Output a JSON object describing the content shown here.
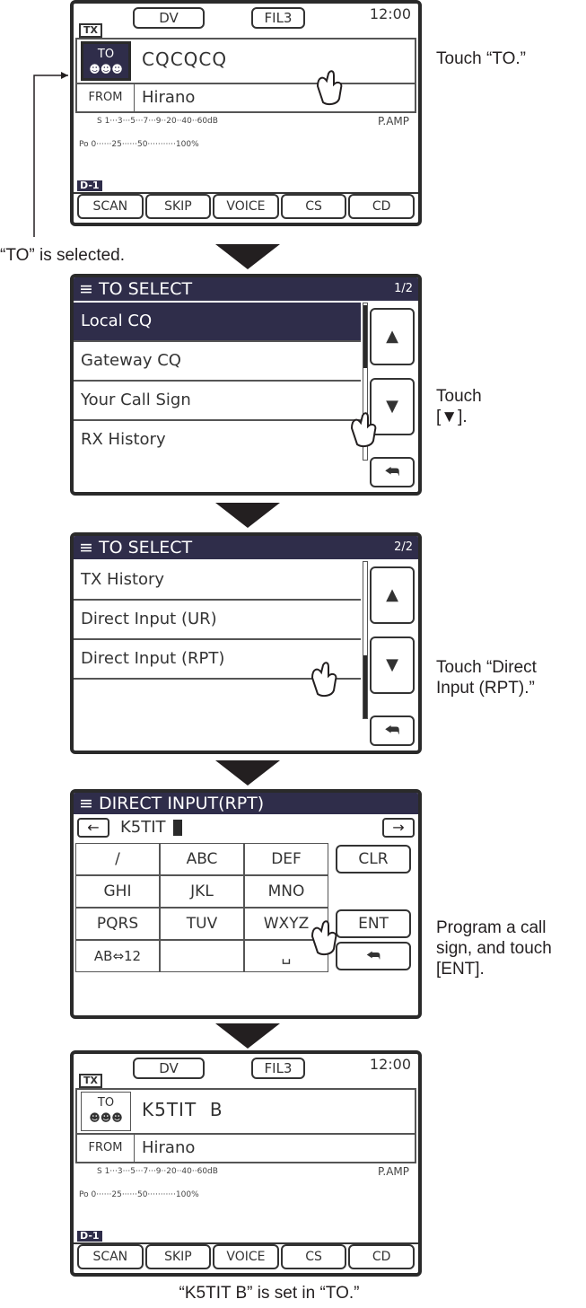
{
  "screen1": {
    "mode": "DV",
    "fil": "FIL3",
    "time": "12:00",
    "tx": "TX",
    "to_label": "TO",
    "to_value": "CQCQCQ",
    "from_label": "FROM",
    "from_value": "Hirano",
    "s_meter": "S 1···3···5···7···9··20··40··60dB",
    "po_meter": "Po 0······25······50···········100%",
    "pamp": "P.AMP",
    "memory": "D-1",
    "softkeys": [
      "SCAN",
      "SKIP",
      "VOICE",
      "CS",
      "CD"
    ]
  },
  "screen2": {
    "title": "TO SELECT",
    "page": "1/2",
    "items": [
      "Local CQ",
      "Gateway CQ",
      "Your Call Sign",
      "RX History"
    ]
  },
  "screen3": {
    "title": "TO SELECT",
    "page": "2/2",
    "items": [
      "TX History",
      "Direct Input (UR)",
      "Direct Input (RPT)",
      ""
    ]
  },
  "screen4": {
    "title": "DIRECT INPUT(RPT)",
    "input_value": "K5TIT",
    "keys": [
      "/",
      "ABC",
      "DEF",
      "GHI",
      "JKL",
      "MNO",
      "PQRS",
      "TUV",
      "WXYZ",
      "AB⇔12",
      "",
      "␣"
    ],
    "clr": "CLR",
    "ent": "ENT"
  },
  "screen5": {
    "mode": "DV",
    "fil": "FIL3",
    "time": "12:00",
    "tx": "TX",
    "to_label": "TO",
    "to_value": "K5TIT  B",
    "from_label": "FROM",
    "from_value": "Hirano",
    "s_meter": "S 1···3···5···7···9··20··40··60dB",
    "po_meter": "Po 0······25······50···········100%",
    "pamp": "P.AMP",
    "memory": "D-1",
    "softkeys": [
      "SCAN",
      "SKIP",
      "VOICE",
      "CS",
      "CD"
    ]
  },
  "notes": {
    "n1": "Touch “TO.”",
    "n_selected": "“TO” is selected.",
    "n2": "Touch [▼].",
    "n3": "Touch “Direct Input (RPT).”",
    "n4": "Program a call sign, and touch [ENT].",
    "n_final": "“K5TIT B” is set in “TO.”"
  },
  "colors": {
    "highlight": "#2f2d4a",
    "frame": "#2a2a2a"
  }
}
